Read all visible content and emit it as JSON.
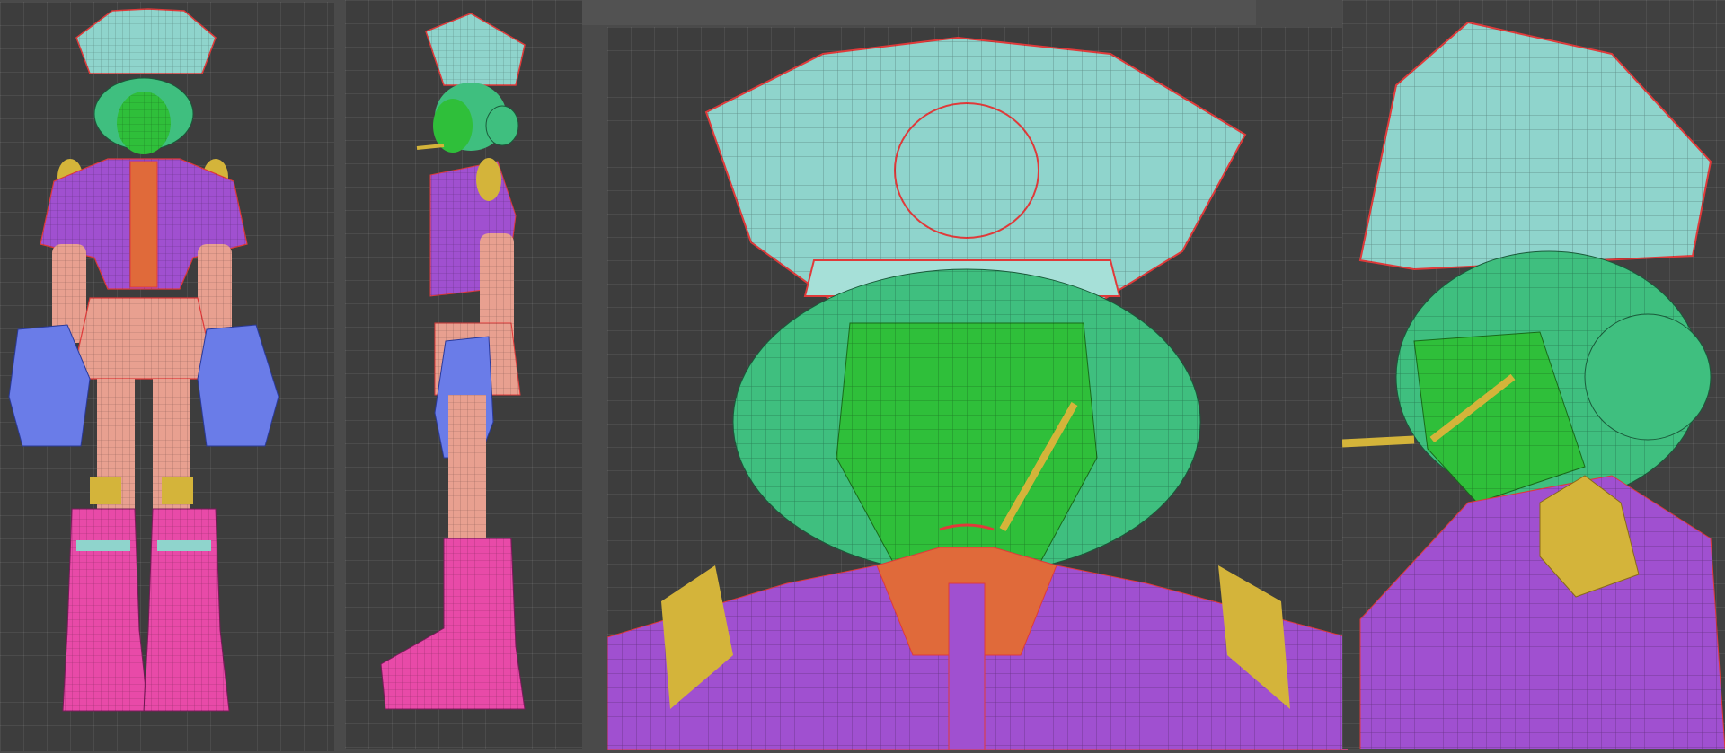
{
  "viewports": [
    {
      "name": "front-view"
    },
    {
      "name": "side-view"
    },
    {
      "name": "head-closeup-front"
    },
    {
      "name": "head-closeup-three-quarter"
    }
  ],
  "colors": {
    "background": "#4a4a4a",
    "grid": "#3d3d3d",
    "hat": "#8fd4cc",
    "hair": "#3fbf7f",
    "skin": "#2fbf3a",
    "jacket": "#a050d0",
    "shoulder_pads": "#d4b43a",
    "vest": "#e06a3a",
    "skirt": "#e8a090",
    "gloves": "#6a7ce8",
    "boots": "#e84aa8",
    "seam_lines": "#e03a3a"
  }
}
